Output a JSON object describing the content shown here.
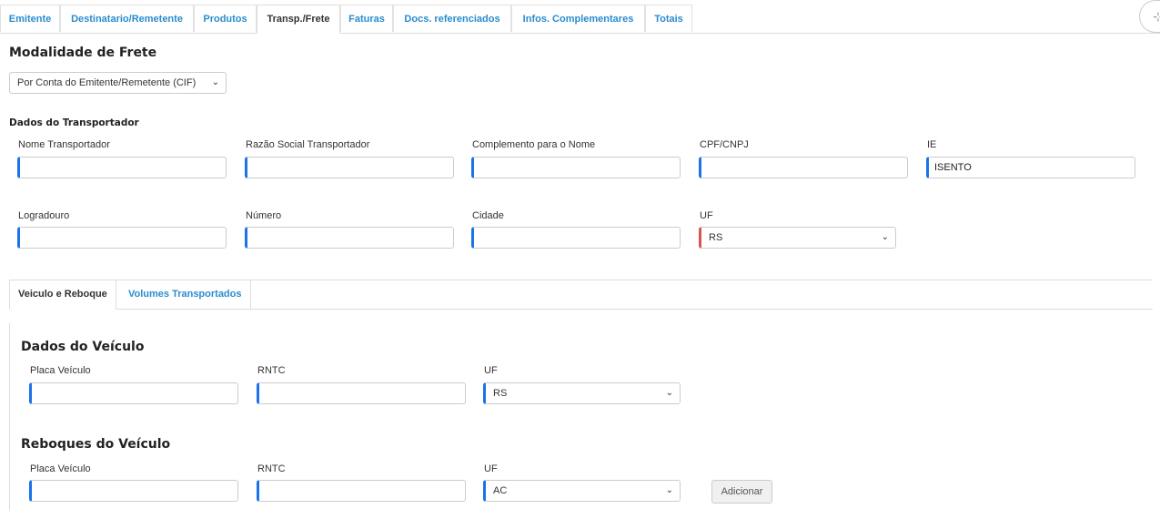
{
  "tabs": [
    "Emitente",
    "Destinatario/Remetente",
    "Produtos",
    "Transp./Frete",
    "Faturas",
    "Docs. referenciados",
    "Infos. Complementares",
    "Totais"
  ],
  "active_tab": "Transp./Frete",
  "modalidade": {
    "title": "Modalidade de Frete",
    "selected": "Por Conta do Emitente/Remetente (CIF)"
  },
  "transportador": {
    "title": "Dados do Transportador",
    "nome_label": "Nome Transportador",
    "razao_label": "Razão Social Transportador",
    "complemento_label": "Complemento para o Nome",
    "cpf_label": "CPF/CNPJ",
    "ie_label": "IE",
    "ie_value": "ISENTO",
    "logradouro_label": "Logradouro",
    "numero_label": "Número",
    "cidade_label": "Cidade",
    "uf_label": "UF",
    "uf_value": "RS"
  },
  "subtabs": [
    "Veiculo e Reboque",
    "Volumes Transportados"
  ],
  "veiculo": {
    "title": "Dados do Veículo",
    "placa_label": "Placa Veículo",
    "rntc_label": "RNTC",
    "uf_label": "UF",
    "uf_value": "RS"
  },
  "reboques": {
    "title": "Reboques do Veículo",
    "placa_label": "Placa Veículo",
    "rntc_label": "RNTC",
    "uf_label": "UF",
    "uf_value": "AC",
    "add_button": "Adicionar"
  },
  "colors": {
    "accent": "#1a74e8",
    "link": "#2a8ccf",
    "required": "#d9534f"
  },
  "icons": {
    "select_arrow": "chevron-down-icon"
  }
}
